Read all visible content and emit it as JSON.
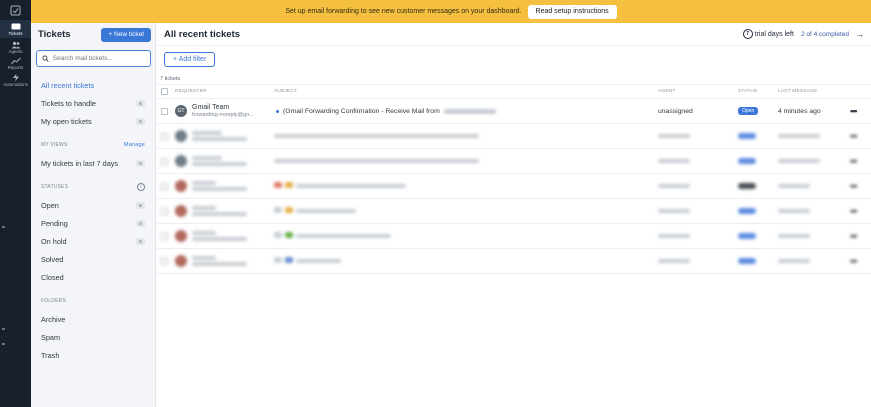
{
  "rail": {
    "items": [
      {
        "label": "",
        "icon": "inbox-icon"
      },
      {
        "label": "Tickets",
        "icon": "ticket-icon"
      },
      {
        "label": "Agents",
        "icon": "agents-icon"
      },
      {
        "label": "Reports",
        "icon": "chart-line-icon"
      },
      {
        "label": "Automations",
        "icon": "bolt-icon"
      }
    ]
  },
  "banner": {
    "text": "Set up email forwarding to see new customer messages on your dashboard.",
    "button": "Read setup instructions",
    "color": "#f5c040"
  },
  "sidebar": {
    "title": "Tickets",
    "new_ticket": "+ New ticket",
    "search_placeholder": "Search mail tickets...",
    "items": [
      {
        "label": "All recent tickets",
        "count": ""
      },
      {
        "label": "Tickets to handle",
        "count": "6"
      },
      {
        "label": "My open tickets",
        "count": "0"
      }
    ],
    "views_header": "MY VIEWS",
    "manage": "Manage",
    "views": [
      {
        "label": "My tickets in last 7 days",
        "count": "0"
      }
    ],
    "statuses_header": "STATUSES",
    "statuses": [
      {
        "label": "Open",
        "count": "6"
      },
      {
        "label": "Pending",
        "count": "0"
      },
      {
        "label": "On hold",
        "count": "0"
      },
      {
        "label": "Solved",
        "count": ""
      },
      {
        "label": "Closed",
        "count": ""
      }
    ],
    "folders_header": "FOLDERS",
    "folders": [
      {
        "label": "Archive"
      },
      {
        "label": "Spam"
      },
      {
        "label": "Trash"
      }
    ]
  },
  "main": {
    "title": "All recent tickets",
    "trial_days": "7",
    "trial_text": "trial days left",
    "completed": "2 of 4 completed",
    "add_filter": "+ Add filter",
    "ticket_count": "7 tickets",
    "columns": [
      "REQUESTER",
      "SUBJECT",
      "AGENT",
      "STATUS",
      "LAST MESSAGE"
    ],
    "first_row": {
      "initials": "GT",
      "name": "Gmail Team",
      "email": "forwarding-noreply@go...",
      "subject": "(Gmail Forwarding Confirmation - Receive Mail from",
      "agent": "unassigned",
      "status": "Open",
      "last_message": "4 minutes ago"
    },
    "accent": "#3a78d8"
  }
}
